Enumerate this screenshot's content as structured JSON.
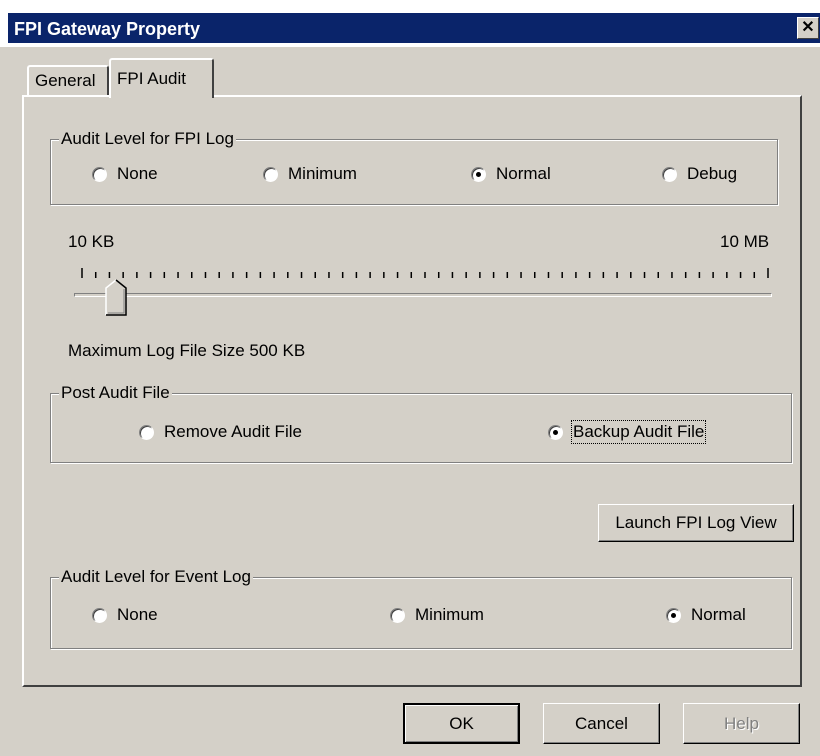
{
  "window": {
    "title": "FPI Gateway Property",
    "close_glyph": "✕"
  },
  "tabs": [
    {
      "label": "General"
    },
    {
      "label": "FPI Audit"
    }
  ],
  "fpi_log_group": {
    "legend": "Audit Level for FPI Log",
    "options": [
      {
        "label": "None",
        "selected": false
      },
      {
        "label": "Minimum",
        "selected": false
      },
      {
        "label": "Normal",
        "selected": true
      },
      {
        "label": "Debug",
        "selected": false
      }
    ]
  },
  "slider": {
    "min_label": "10 KB",
    "max_label": "10 MB",
    "tick_count": 51,
    "value_kb": 500,
    "value_fraction": 0.05,
    "size_label": "Maximum Log File Size 500 KB"
  },
  "post_audit_group": {
    "legend": "Post Audit File",
    "options": [
      {
        "label": "Remove Audit File",
        "selected": false
      },
      {
        "label": "Backup Audit File",
        "selected": true
      }
    ]
  },
  "launch_button": {
    "label": "Launch FPI Log View"
  },
  "event_log_group": {
    "legend": "Audit Level for Event Log",
    "options": [
      {
        "label": "None",
        "selected": false
      },
      {
        "label": "Minimum",
        "selected": false
      },
      {
        "label": "Normal",
        "selected": true
      }
    ]
  },
  "footer": {
    "ok_label": "OK",
    "cancel_label": "Cancel",
    "help_label": "Help",
    "help_enabled": false
  },
  "colors": {
    "title_bar": "#0a246a",
    "face": "#d4d0c8"
  }
}
